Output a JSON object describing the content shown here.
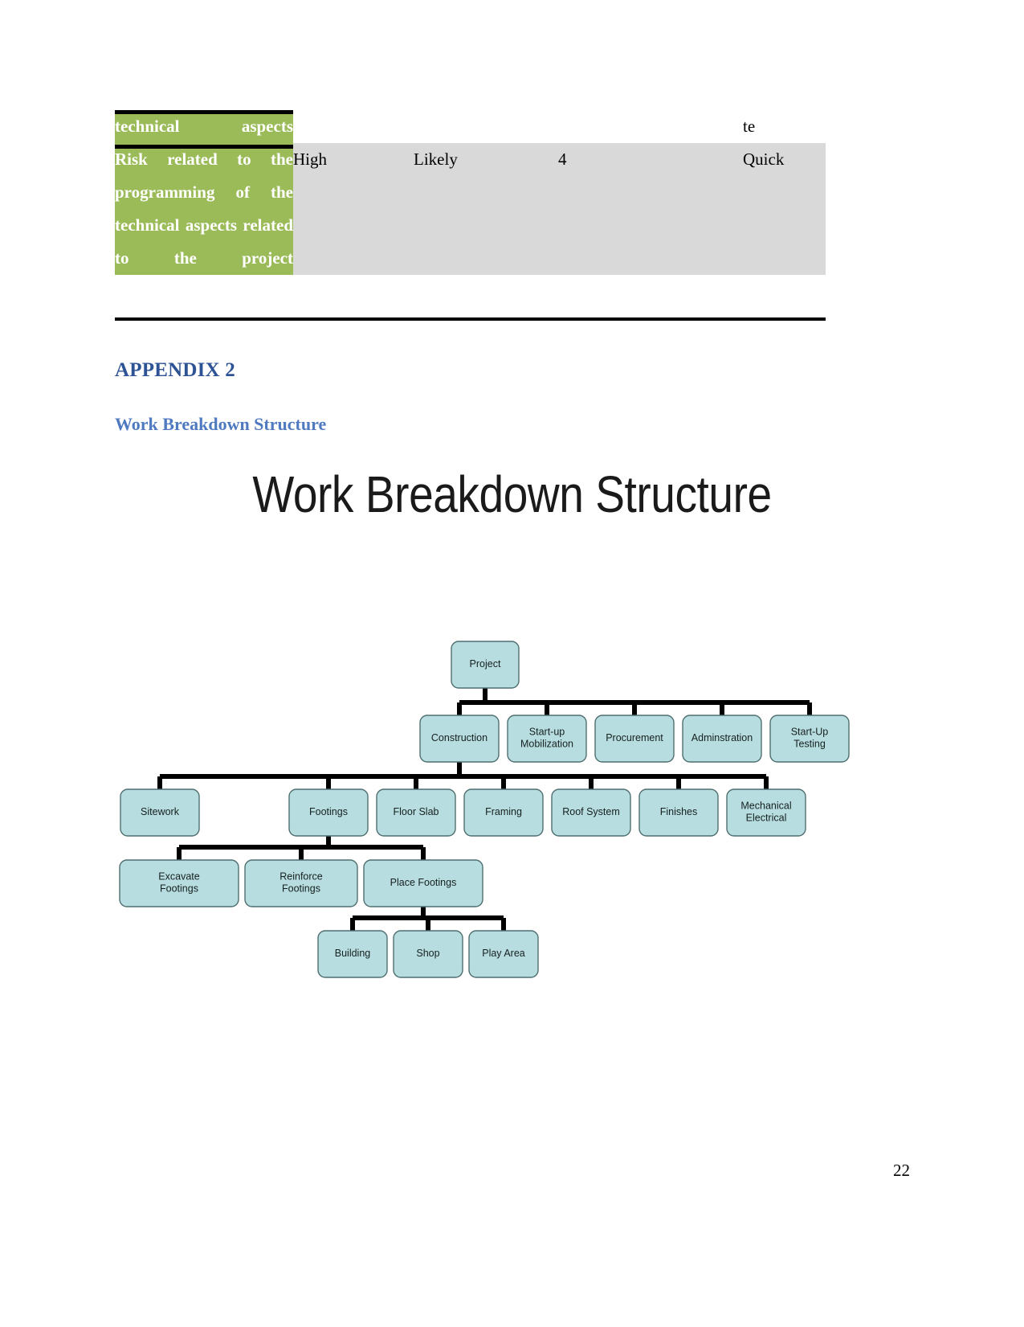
{
  "document": {
    "page_number": "22"
  },
  "risk_table": {
    "rows": [
      {
        "label": "technical aspects",
        "severity": "",
        "likelihood": "",
        "score": "",
        "response": "te",
        "shaded": false
      },
      {
        "label": "Risk related to the programming of the technical aspects related to the project",
        "severity": "High",
        "likelihood": "Likely",
        "score": "4",
        "response": "Quick",
        "shaded": true
      }
    ],
    "label_bg": "#9BBB59",
    "shaded_bg": "#d9d9d9"
  },
  "headings": {
    "appendix": "APPENDIX 2",
    "appendix_color": "#2E5395",
    "subheading": "Work Breakdown Structure",
    "subheading_color": "#4F7AC0"
  },
  "figure": {
    "title": "Work Breakdown Structure",
    "node_fill": "#b8dde0",
    "node_stroke": "#4f6f70",
    "link_color": "#000000",
    "levels": [
      {
        "level": 1,
        "nodes": [
          {
            "id": "project",
            "label": "Project"
          }
        ]
      },
      {
        "level": 2,
        "nodes": [
          {
            "id": "construction",
            "label": "Construction"
          },
          {
            "id": "startup-mobilization",
            "label": "Start-up Mobilization",
            "lines": [
              "Start-up",
              "Mobilization"
            ]
          },
          {
            "id": "procurement",
            "label": "Procurement"
          },
          {
            "id": "adminstration",
            "label": "Adminstration"
          },
          {
            "id": "startup-testing",
            "label": "Start-Up Testing",
            "lines": [
              "Start-Up",
              "Testing"
            ]
          }
        ]
      },
      {
        "level": 3,
        "nodes": [
          {
            "id": "sitework",
            "label": "Sitework"
          },
          {
            "id": "footings",
            "label": "Footings"
          },
          {
            "id": "floor-slab",
            "label": "Floor Slab"
          },
          {
            "id": "framing",
            "label": "Framing"
          },
          {
            "id": "roof-system",
            "label": "Roof System"
          },
          {
            "id": "finishes",
            "label": "Finishes"
          },
          {
            "id": "mechanical-electrical",
            "label": "Mechanical Electrical",
            "lines": [
              "Mechanical",
              "Electrical"
            ]
          }
        ]
      },
      {
        "level": 4,
        "nodes": [
          {
            "id": "excavate-footings",
            "label": "Excavate Footings",
            "lines": [
              "Excavate",
              "Footings"
            ]
          },
          {
            "id": "reinforce-footings",
            "label": "Reinforce Footings",
            "lines": [
              "Reinforce",
              "Footings"
            ]
          },
          {
            "id": "place-footings",
            "label": "Place Footings"
          }
        ]
      },
      {
        "level": 5,
        "nodes": [
          {
            "id": "building",
            "label": "Building"
          },
          {
            "id": "shop",
            "label": "Shop"
          },
          {
            "id": "play-area",
            "label": "Play Area"
          }
        ]
      }
    ]
  }
}
